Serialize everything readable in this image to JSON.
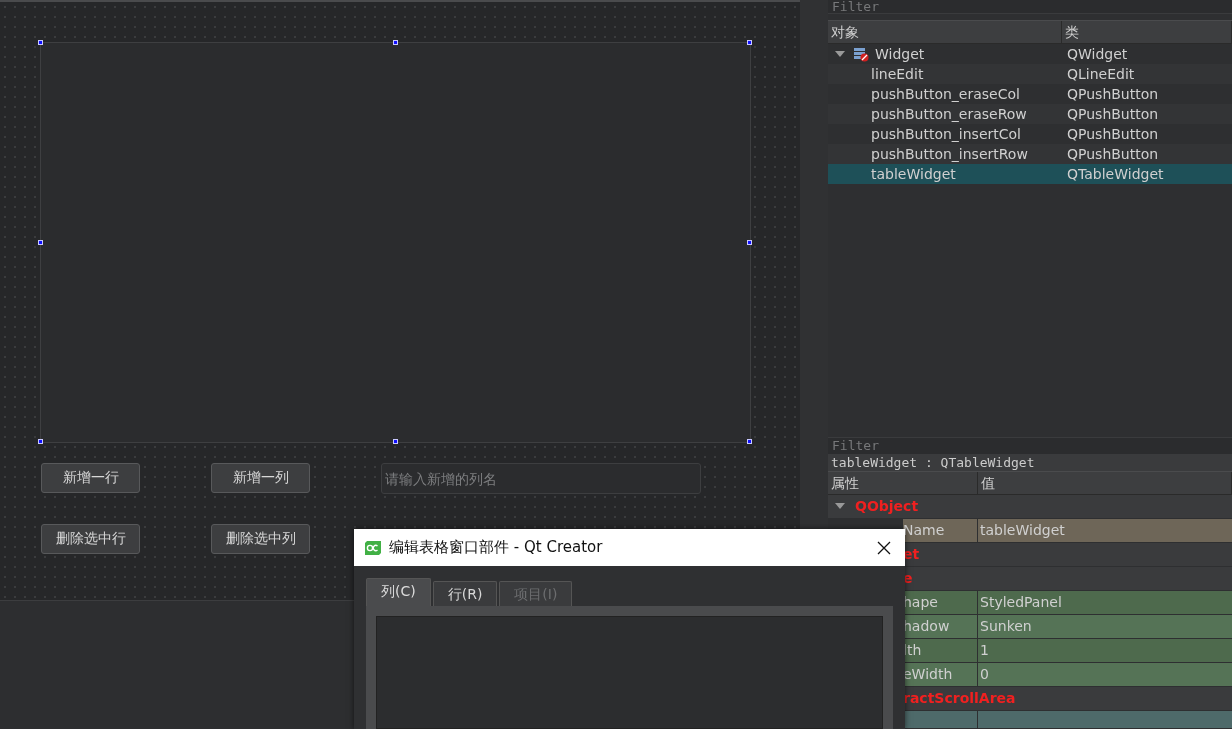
{
  "form": {
    "buttons": [
      {
        "label": "新增一行"
      },
      {
        "label": "新增一列"
      },
      {
        "label": "删除选中行"
      },
      {
        "label": "删除选中列"
      }
    ],
    "line_edit": {
      "placeholder": "请输入新增的列名"
    }
  },
  "object_inspector": {
    "filter": {
      "placeholder": "Filter"
    },
    "columns": [
      "对象",
      "类"
    ],
    "tree": [
      {
        "name": "Widget",
        "class": "QWidget",
        "expanded": true,
        "selected": false,
        "children": [
          {
            "name": "lineEdit",
            "class": "QLineEdit",
            "selected": false
          },
          {
            "name": "pushButton_eraseCol",
            "class": "QPushButton",
            "selected": false
          },
          {
            "name": "pushButton_eraseRow",
            "class": "QPushButton",
            "selected": false
          },
          {
            "name": "pushButton_insertCol",
            "class": "QPushButton",
            "selected": false
          },
          {
            "name": "pushButton_insertRow",
            "class": "QPushButton",
            "selected": false
          },
          {
            "name": "tableWidget",
            "class": "QTableWidget",
            "selected": true
          }
        ]
      }
    ]
  },
  "property_editor": {
    "filter": {
      "placeholder": "Filter"
    },
    "object": "tableWidget : QTableWidget",
    "columns": [
      "属性",
      "值"
    ],
    "rows": [
      {
        "kind": "category",
        "label": "QObject",
        "expanded": true
      },
      {
        "kind": "property",
        "label": "Name",
        "value": "tableWidget",
        "color": "#6e6658"
      },
      {
        "kind": "category",
        "label": "et"
      },
      {
        "kind": "category",
        "label": "e"
      },
      {
        "kind": "property",
        "label": "hape",
        "value": "StyledPanel",
        "color": "#4e6a4d"
      },
      {
        "kind": "property",
        "label": "hadow",
        "value": "Sunken",
        "color": "#557356"
      },
      {
        "kind": "property",
        "label": "lth",
        "value": "1",
        "color": "#4e6a4d"
      },
      {
        "kind": "property",
        "label": "eWidth",
        "value": "0",
        "color": "#557356"
      },
      {
        "kind": "category",
        "label": "ractScrollArea"
      },
      {
        "kind": "property",
        "label": "",
        "value": "",
        "color": "#4e6a6a"
      }
    ]
  },
  "dialog": {
    "title": "编辑表格窗口部件 - Qt Creator",
    "tabs": [
      {
        "label": "列(C)",
        "selected": true,
        "disabled": false
      },
      {
        "label": "行(R)",
        "selected": false,
        "disabled": false
      },
      {
        "label": "项目(I)",
        "selected": false,
        "disabled": true
      }
    ]
  }
}
